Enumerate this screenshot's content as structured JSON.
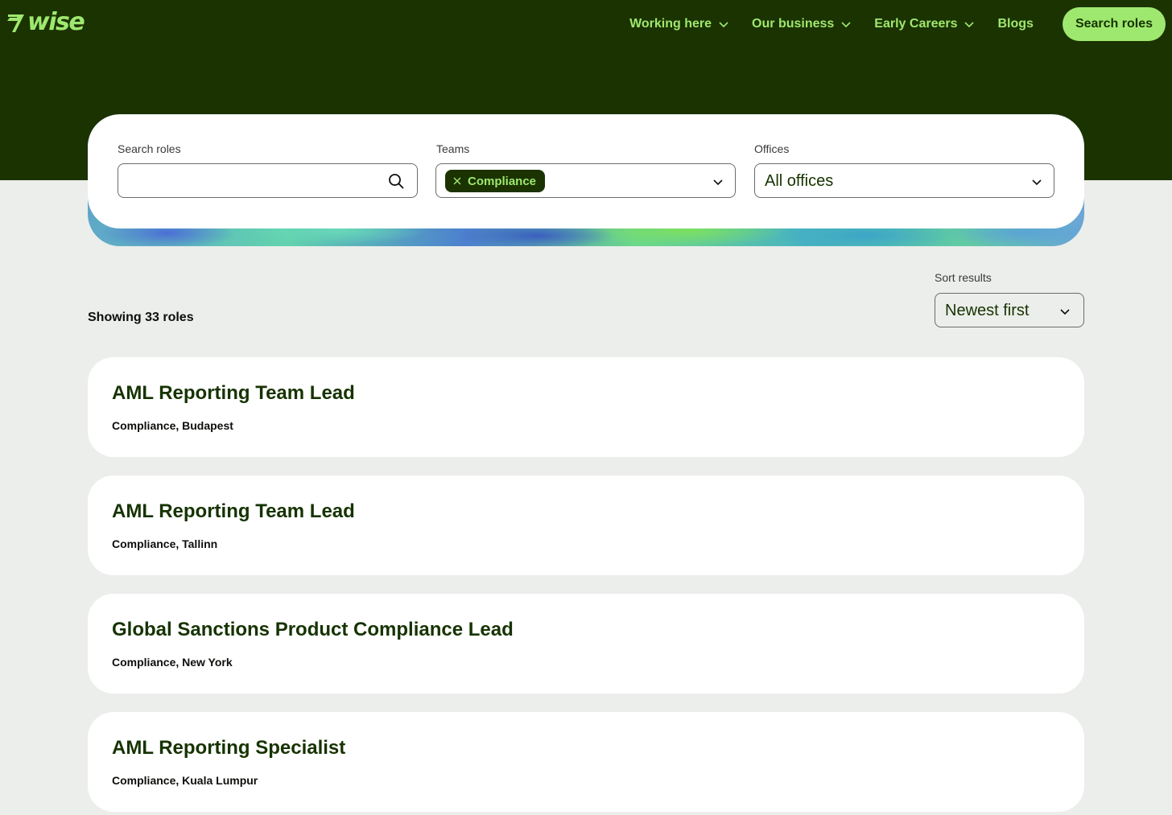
{
  "brand": {
    "name": "wise",
    "accent": "#9fe870",
    "dark": "#1b3300",
    "background": "#eceeeb"
  },
  "nav": {
    "items": [
      {
        "label": "Working here",
        "has_dropdown": true
      },
      {
        "label": "Our business",
        "has_dropdown": true
      },
      {
        "label": "Early Careers",
        "has_dropdown": true
      },
      {
        "label": "Blogs",
        "has_dropdown": false
      }
    ],
    "cta_label": "Search roles"
  },
  "filters": {
    "search": {
      "label": "Search roles",
      "value": "",
      "icon": "search-icon"
    },
    "teams": {
      "label": "Teams",
      "selected_chip": "Compliance",
      "icon": "chevron-down-icon"
    },
    "offices": {
      "label": "Offices",
      "value": "All offices",
      "icon": "chevron-down-icon"
    }
  },
  "results": {
    "showing_text": "Showing 33 roles",
    "sort_label": "Sort results",
    "sort_value": "Newest first"
  },
  "jobs": [
    {
      "title": "AML Reporting Team Lead",
      "meta": "Compliance, Budapest"
    },
    {
      "title": "AML Reporting Team Lead",
      "meta": "Compliance, Tallinn"
    },
    {
      "title": "Global Sanctions Product Compliance Lead",
      "meta": "Compliance, New York"
    },
    {
      "title": "AML Reporting Specialist",
      "meta": "Compliance, Kuala Lumpur"
    }
  ]
}
